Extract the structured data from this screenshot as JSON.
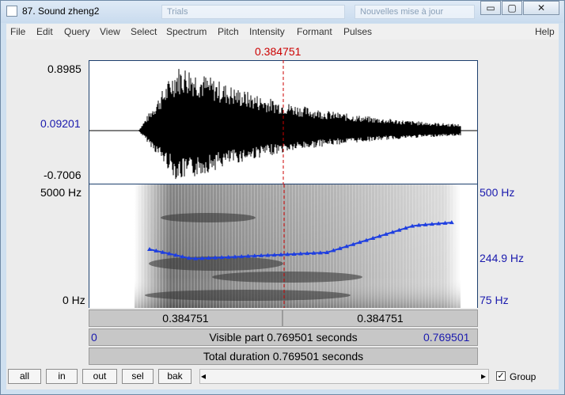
{
  "window": {
    "title": "87. Sound zheng2",
    "minimize_glyph": "▭",
    "maximize_glyph": "▢",
    "close_glyph": "✕",
    "background_tab_1": "Trials",
    "background_tab_2": "Nouvelles mise à jour"
  },
  "menu": [
    "File",
    "Edit",
    "Query",
    "View",
    "Select",
    "Spectrum",
    "Pitch",
    "Intensity",
    "Formant",
    "Pulses"
  ],
  "help_label": "Help",
  "cursor_time": "0.384751",
  "waveform": {
    "max_label": "0.8985",
    "mid_label": "0.09201",
    "min_label": "-0.7006"
  },
  "spectrogram": {
    "top_freq": "5000 Hz",
    "bottom_freq": "0 Hz",
    "pitch_top": "500 Hz",
    "pitch_mid": "244.9 Hz",
    "pitch_bottom": "75 Hz"
  },
  "time_bars": {
    "left_segment": "0.384751",
    "right_segment": "0.384751",
    "visible_start": "0",
    "visible_label": "Visible part 0.769501 seconds",
    "visible_end": "0.769501",
    "total_label": "Total duration 0.769501 seconds"
  },
  "buttons": {
    "all": "all",
    "in": "in",
    "out": "out",
    "sel": "sel",
    "bak": "bak"
  },
  "scroll": {
    "left_arrow": "◂",
    "right_arrow": "▸"
  },
  "group": {
    "label": "Group",
    "checked": true,
    "check_glyph": "✓"
  },
  "colors": {
    "pitch_track": "#1f3fe0",
    "cursor_line": "#cc0000",
    "axis_blue": "#1a1aae"
  },
  "icons": {
    "window_icon": "app-icon",
    "minimize": "minimize-icon",
    "maximize": "maximize-icon",
    "close": "close-icon"
  }
}
